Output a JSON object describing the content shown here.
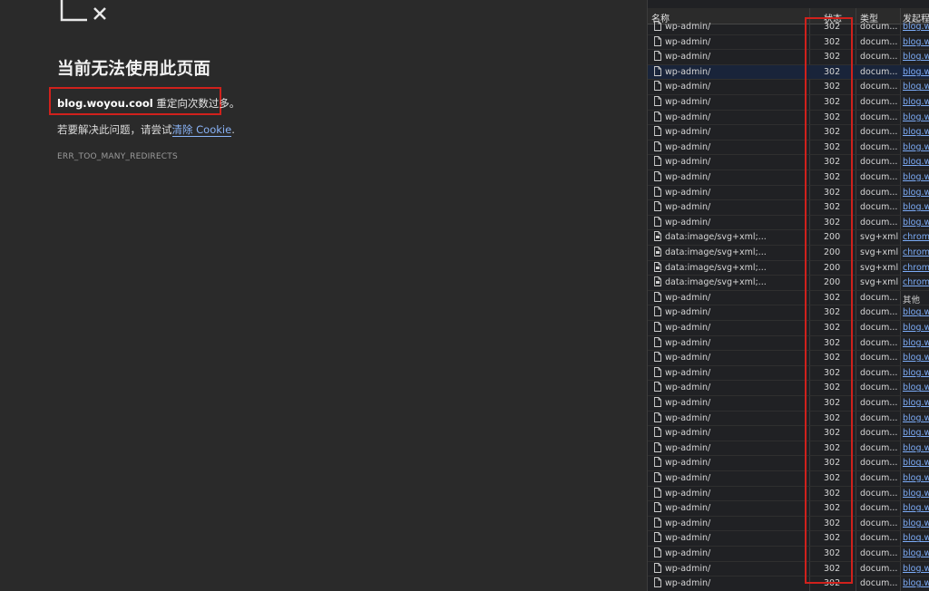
{
  "error_page": {
    "title": "当前无法使用此页面",
    "redirect_domain": "blog.woyou.cool",
    "redirect_text": " 重定向次数过多。",
    "hint_prefix": "若要解决此问题，请尝试",
    "hint_link": "清除 Cookie",
    "hint_suffix": ".",
    "error_code": "ERR_TOO_MANY_REDIRECTS",
    "icon": "broken-page-icon"
  },
  "network": {
    "columns": {
      "name": "名称",
      "status": "状态",
      "type": "类型",
      "initiator": "发起程"
    },
    "highlight_color": "#d0211c",
    "rows": [
      {
        "name": "wp-admin/",
        "status": "302",
        "type": "docum...",
        "initiator": "blog.w",
        "partial": true
      },
      {
        "name": "wp-admin/",
        "status": "302",
        "type": "docum...",
        "initiator": "blog.w"
      },
      {
        "name": "wp-admin/",
        "status": "302",
        "type": "docum...",
        "initiator": "blog.w"
      },
      {
        "name": "wp-admin/",
        "status": "302",
        "type": "docum...",
        "initiator": "blog.w",
        "selected": true
      },
      {
        "name": "wp-admin/",
        "status": "302",
        "type": "docum...",
        "initiator": "blog.w"
      },
      {
        "name": "wp-admin/",
        "status": "302",
        "type": "docum...",
        "initiator": "blog.w"
      },
      {
        "name": "wp-admin/",
        "status": "302",
        "type": "docum...",
        "initiator": "blog.w"
      },
      {
        "name": "wp-admin/",
        "status": "302",
        "type": "docum...",
        "initiator": "blog.w"
      },
      {
        "name": "wp-admin/",
        "status": "302",
        "type": "docum...",
        "initiator": "blog.w"
      },
      {
        "name": "wp-admin/",
        "status": "302",
        "type": "docum...",
        "initiator": "blog.w"
      },
      {
        "name": "wp-admin/",
        "status": "302",
        "type": "docum...",
        "initiator": "blog.w"
      },
      {
        "name": "wp-admin/",
        "status": "302",
        "type": "docum...",
        "initiator": "blog.w"
      },
      {
        "name": "wp-admin/",
        "status": "302",
        "type": "docum...",
        "initiator": "blog.w"
      },
      {
        "name": "wp-admin/",
        "status": "302",
        "type": "docum...",
        "initiator": "blog.w"
      },
      {
        "name": "data:image/svg+xml;...",
        "status": "200",
        "type": "svg+xml",
        "initiator": "chrome"
      },
      {
        "name": "data:image/svg+xml;...",
        "status": "200",
        "type": "svg+xml",
        "initiator": "chrome"
      },
      {
        "name": "data:image/svg+xml;...",
        "status": "200",
        "type": "svg+xml",
        "initiator": "chrome"
      },
      {
        "name": "data:image/svg+xml;...",
        "status": "200",
        "type": "svg+xml",
        "initiator": "chrome"
      },
      {
        "name": "wp-admin/",
        "status": "302",
        "type": "docum...",
        "initiator": "其他",
        "plain": true
      },
      {
        "name": "wp-admin/",
        "status": "302",
        "type": "docum...",
        "initiator": "blog.w"
      },
      {
        "name": "wp-admin/",
        "status": "302",
        "type": "docum...",
        "initiator": "blog.w"
      },
      {
        "name": "wp-admin/",
        "status": "302",
        "type": "docum...",
        "initiator": "blog.w"
      },
      {
        "name": "wp-admin/",
        "status": "302",
        "type": "docum...",
        "initiator": "blog.w"
      },
      {
        "name": "wp-admin/",
        "status": "302",
        "type": "docum...",
        "initiator": "blog.w"
      },
      {
        "name": "wp-admin/",
        "status": "302",
        "type": "docum...",
        "initiator": "blog.w"
      },
      {
        "name": "wp-admin/",
        "status": "302",
        "type": "docum...",
        "initiator": "blog.w"
      },
      {
        "name": "wp-admin/",
        "status": "302",
        "type": "docum...",
        "initiator": "blog.w"
      },
      {
        "name": "wp-admin/",
        "status": "302",
        "type": "docum...",
        "initiator": "blog.w"
      },
      {
        "name": "wp-admin/",
        "status": "302",
        "type": "docum...",
        "initiator": "blog.w"
      },
      {
        "name": "wp-admin/",
        "status": "302",
        "type": "docum...",
        "initiator": "blog.w"
      },
      {
        "name": "wp-admin/",
        "status": "302",
        "type": "docum...",
        "initiator": "blog.w"
      },
      {
        "name": "wp-admin/",
        "status": "302",
        "type": "docum...",
        "initiator": "blog.w"
      },
      {
        "name": "wp-admin/",
        "status": "302",
        "type": "docum...",
        "initiator": "blog.w"
      },
      {
        "name": "wp-admin/",
        "status": "302",
        "type": "docum...",
        "initiator": "blog.w"
      },
      {
        "name": "wp-admin/",
        "status": "302",
        "type": "docum...",
        "initiator": "blog.w"
      },
      {
        "name": "wp-admin/",
        "status": "302",
        "type": "docum...",
        "initiator": "blog.w"
      },
      {
        "name": "wp-admin/",
        "status": "302",
        "type": "docum...",
        "initiator": "blog.w"
      },
      {
        "name": "wp-admin/",
        "status": "302",
        "type": "docum...",
        "initiator": "blog.w"
      }
    ]
  }
}
